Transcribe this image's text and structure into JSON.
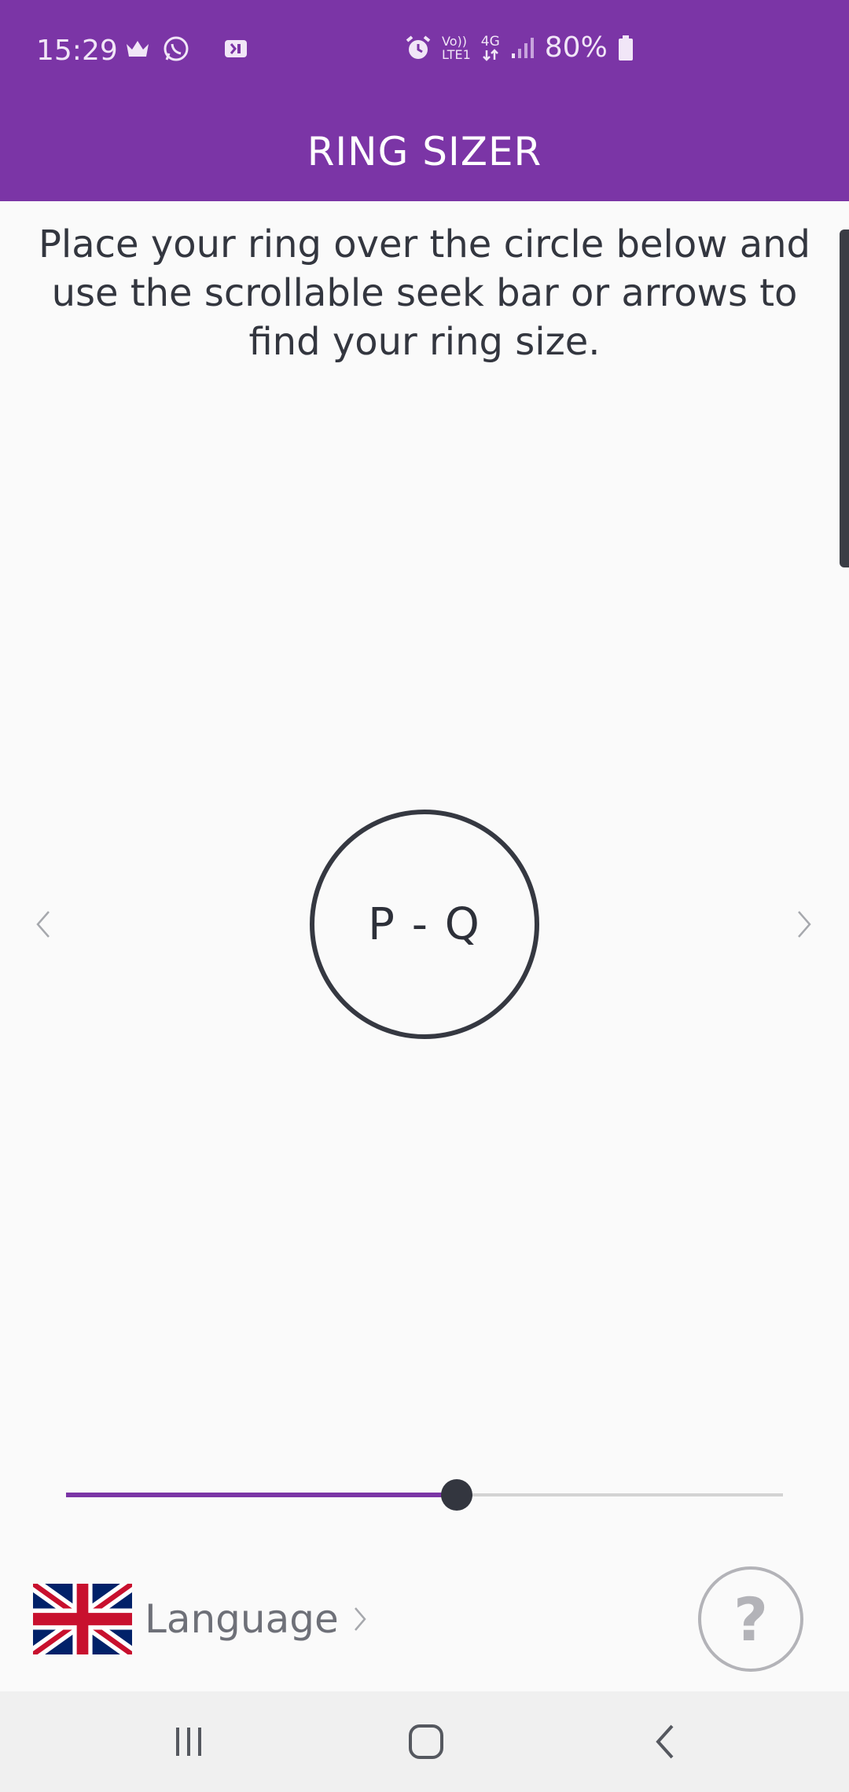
{
  "status_bar": {
    "time": "15:29",
    "left_icons": [
      "crown-icon",
      "whatsapp-icon",
      "card-app-icon"
    ],
    "right_icons": [
      "alarm-icon",
      "volte-icon",
      "4g-icon",
      "signal-icon",
      "battery-icon"
    ],
    "volte_text": "Vo))",
    "lte_text": "LTE1",
    "network_text": "4G",
    "battery_percent": "80%"
  },
  "app_bar": {
    "title": "RING SIZER"
  },
  "instructions": "Place your ring over the circle below and use the scrollable seek bar or arrows to find your ring size.",
  "ring": {
    "size_label": "P - Q"
  },
  "seekbar": {
    "progress": 0.545
  },
  "language": {
    "label": "Language",
    "flag": "uk-flag-icon"
  },
  "help": {
    "glyph": "?"
  },
  "colors": {
    "accent": "#7b35a6",
    "text": "#33363f",
    "muted": "#6e7078"
  }
}
